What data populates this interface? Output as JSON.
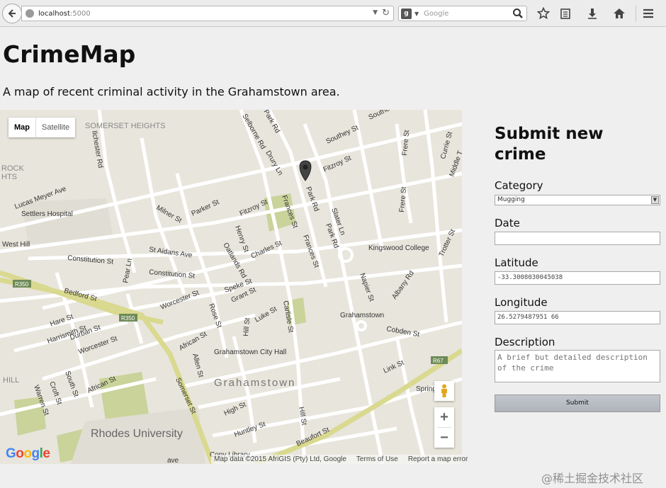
{
  "browser": {
    "url_host": "localhost",
    "url_port": ":5000",
    "search_placeholder": "Google",
    "search_engine_letter": "g"
  },
  "page": {
    "title": "CrimeMap",
    "intro": "A map of recent criminal activity in the Grahamstown area."
  },
  "map": {
    "type_controls": [
      "Map",
      "Satellite"
    ],
    "active_type": "Map",
    "google_logo": "Google",
    "attribution": {
      "data": "Map data ©2015 AfriGIS (Pty) Ltd, Google",
      "terms": "Terms of Use",
      "report": "Report a map error"
    },
    "zoom_in": "+",
    "zoom_out": "−",
    "labels": {
      "somerset_heights": "SOMERSET HEIGHTS",
      "rock": "ROCK",
      "hts": "HTS",
      "hill": "HILL",
      "ilchester_rd": "Ilchester Rd",
      "lucas_meyer_ave": "Lucas Meyer Ave",
      "settlers_hospital": "Settlers Hospital",
      "west_hill": "West Hill",
      "constitution_st_1": "Constitution St",
      "constitution_st_2": "Constitution St",
      "r350_1": "R350",
      "r350_2": "R350",
      "r67": "R67",
      "bedford_st": "Bedford St",
      "pear_ln": "Pear Ln",
      "hare_st": "Hare St",
      "harrismith_st": "Harrismith St",
      "durban_st": "Durban St",
      "worcester_st_1": "Worcester St",
      "worcester_st_2": "Worcester St",
      "african_st_1": "African St",
      "african_st_2": "African St",
      "south_st": "South St",
      "croft_st": "Croft St",
      "warren_st": "Warren St",
      "somerset_st": "Somerset St",
      "allen_st": "Allen St",
      "rose_st": "Rose St",
      "speke_st": "Speke St",
      "grant_st": "Grant St",
      "hill_st_1": "Hill St",
      "hill_st_2": "Hill St",
      "luke_st": "Luke St",
      "carlisle_st": "Carlisle St",
      "high_st": "High St",
      "huntley_st": "Huntley St",
      "beaufort_st": "Beaufort St",
      "grahamstown": "Grahamstown",
      "grahamstown_city_hall": "Grahamstown City Hall",
      "grahamstown_station": "Grahamstown",
      "cobden_st": "Cobden St",
      "link_st": "Link St",
      "spring": "Spring",
      "copy_library": "Copy Library",
      "rhodes_university": "Rhodes University",
      "milner_st": "Milner St",
      "st_aidans_ave": "St Aidans Ave",
      "parker_st": "Parker St",
      "fitzroy_st_1": "Fitzroy St",
      "fitzroy_st_2": "Fitzroy St",
      "henry_st": "Henry St",
      "oatlands_rd": "Oatlands Rd",
      "charles_st": "Charles St",
      "frances_st_1": "Frances St",
      "frances_st_2": "Frances St",
      "park_rd_1": "Park Rd",
      "park_rd_2": "Park Rd",
      "park_rd_3": "Park Rd",
      "selborne_rd": "Selborne Rd",
      "drury_ln": "Drury Ln",
      "southey_st": "Southey St",
      "southe": "Southe",
      "slater_ln": "Slater Ln",
      "kingswood_college": "Kingswood College",
      "napier_st": "Napier St",
      "albany_rd": "Albany Rd",
      "trotter_st": "Trotter St",
      "frere_st_1": "Frere St",
      "frere_st_2": "Frere St",
      "currie_st": "Currie St",
      "middle": "Middle T",
      "ave": "ave"
    }
  },
  "form": {
    "title": "Submit new crime",
    "category_label": "Category",
    "category_value": "Mugging",
    "date_label": "Date",
    "date_value": "",
    "latitude_label": "Latitude",
    "latitude_value": "-33.3008030045038",
    "longitude_label": "Longitude",
    "longitude_value": "26.5279487951 66",
    "description_label": "Description",
    "description_placeholder": "A brief but detailed description of the crime",
    "submit_label": "Submit"
  },
  "watermark": "@稀土掘金技术社区",
  "colors": {
    "map_bg": "#e8e5dc",
    "road": "#ffffff",
    "arterial": "#d9d98f",
    "park": "#c9d39a"
  }
}
